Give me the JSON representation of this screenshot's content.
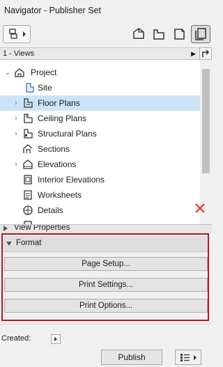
{
  "window": {
    "title": "Navigator - Publisher Set"
  },
  "toolbar": {
    "buttons": [
      {
        "name": "project-map-icon"
      },
      {
        "name": "view-map-icon"
      },
      {
        "name": "layout-book-icon"
      },
      {
        "name": "publisher-sets-icon",
        "active": true
      }
    ]
  },
  "view_selector": {
    "value": "1 - Views"
  },
  "tree": {
    "items": [
      {
        "label": "Project",
        "icon": "project-icon",
        "expanded": true
      },
      {
        "label": "Site",
        "icon": "site-icon"
      },
      {
        "label": "Floor Plans",
        "icon": "floor-plan-icon",
        "collapsed": true,
        "selected": true
      },
      {
        "label": "Ceiling Plans",
        "icon": "ceiling-plan-icon",
        "collapsed": true
      },
      {
        "label": "Structural Plans",
        "icon": "structural-plan-icon",
        "collapsed": true
      },
      {
        "label": "Sections",
        "icon": "section-icon"
      },
      {
        "label": "Elevations",
        "icon": "elevation-icon",
        "collapsed": true
      },
      {
        "label": "Interior Elevations",
        "icon": "interior-elevation-icon"
      },
      {
        "label": "Worksheets",
        "icon": "worksheet-icon"
      },
      {
        "label": "Details",
        "icon": "detail-icon"
      }
    ]
  },
  "view_properties": {
    "label": "View Properties"
  },
  "format": {
    "label": "Format",
    "buttons": [
      "Page Setup...",
      "Print Settings...",
      "Print Options..."
    ]
  },
  "created": {
    "label": "Created:"
  },
  "footer": {
    "publish_label": "Publish"
  },
  "colors": {
    "selection": "#cce4f7",
    "highlight_border": "#b3181e",
    "close_x": "#e5322a"
  }
}
